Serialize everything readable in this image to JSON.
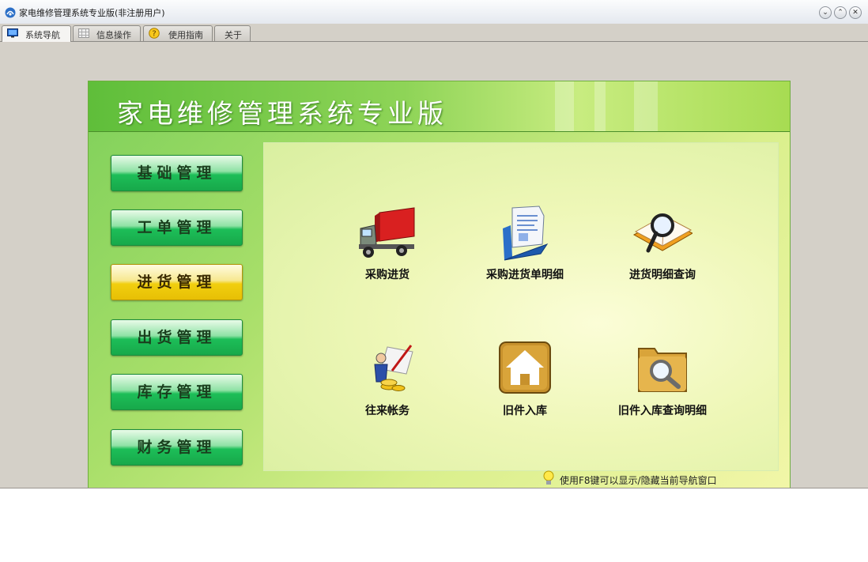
{
  "window": {
    "title": "家电维修管理系统专业版(非注册用户)",
    "controls": [
      "⌄",
      "⌃",
      "✕"
    ]
  },
  "tabs": [
    {
      "label": "系统导航",
      "icon": "monitor-icon",
      "active": true
    },
    {
      "label": "信息操作",
      "icon": "grid-icon",
      "active": false
    },
    {
      "label": "使用指南",
      "icon": "help-icon",
      "active": false
    },
    {
      "label": "关于",
      "icon": "",
      "active": false
    }
  ],
  "banner": {
    "title": "家电维修管理系统专业版"
  },
  "nav": [
    {
      "label": "基础管理",
      "active": false
    },
    {
      "label": "工单管理",
      "active": false
    },
    {
      "label": "进货管理",
      "active": true
    },
    {
      "label": "出货管理",
      "active": false
    },
    {
      "label": "库存管理",
      "active": false
    },
    {
      "label": "财务管理",
      "active": false
    }
  ],
  "functions": [
    {
      "label": "采购进货",
      "icon": "truck-icon"
    },
    {
      "label": "采购进货单明细",
      "icon": "document-folder-icon"
    },
    {
      "label": "进货明细查询",
      "icon": "book-magnifier-icon"
    },
    {
      "label": "往来帐务",
      "icon": "accounting-person-icon"
    },
    {
      "label": "旧件入库",
      "icon": "house-icon"
    },
    {
      "label": "旧件入库查询明细",
      "icon": "folder-search-icon"
    }
  ],
  "hint": "使用F8键可以显示/隐藏当前导航窗口",
  "colors": {
    "accent_green": "#1dbe58",
    "active_yellow": "#f1cf0f"
  }
}
